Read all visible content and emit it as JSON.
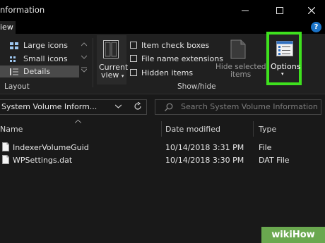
{
  "window": {
    "title": "nformation",
    "minimize": "—",
    "maximize": "☐",
    "close": "✕"
  },
  "ribbon": {
    "tab": "iew",
    "help": "?",
    "layout": {
      "items": [
        "Large icons",
        "Small icons",
        "Details"
      ],
      "group_label": "Layout"
    },
    "current_view": {
      "line1": "Current",
      "line2": "view"
    },
    "show_hide": {
      "checkboxes": [
        "Item check boxes",
        "File name extensions",
        "Hidden items"
      ],
      "hide_selected_line1": "Hide selected",
      "hide_selected_line2": "items",
      "group_label": "Show/hide"
    },
    "options": {
      "label": "Options"
    }
  },
  "address": {
    "path": "System Volume Inform...",
    "search_placeholder": "Search System Volume Information"
  },
  "columns": [
    "Name",
    "Date modified",
    "Type"
  ],
  "files": [
    {
      "name": "IndexerVolumeGuid",
      "date": "10/14/2018 3:31 PM",
      "type": "File"
    },
    {
      "name": "WPSettings.dat",
      "date": "10/14/2018 3:30 PM",
      "type": "DAT File"
    }
  ],
  "watermark": "wikiHow",
  "colors": {
    "highlight": "#3ee11e",
    "background": "#191919",
    "ribbon": "#202020"
  }
}
